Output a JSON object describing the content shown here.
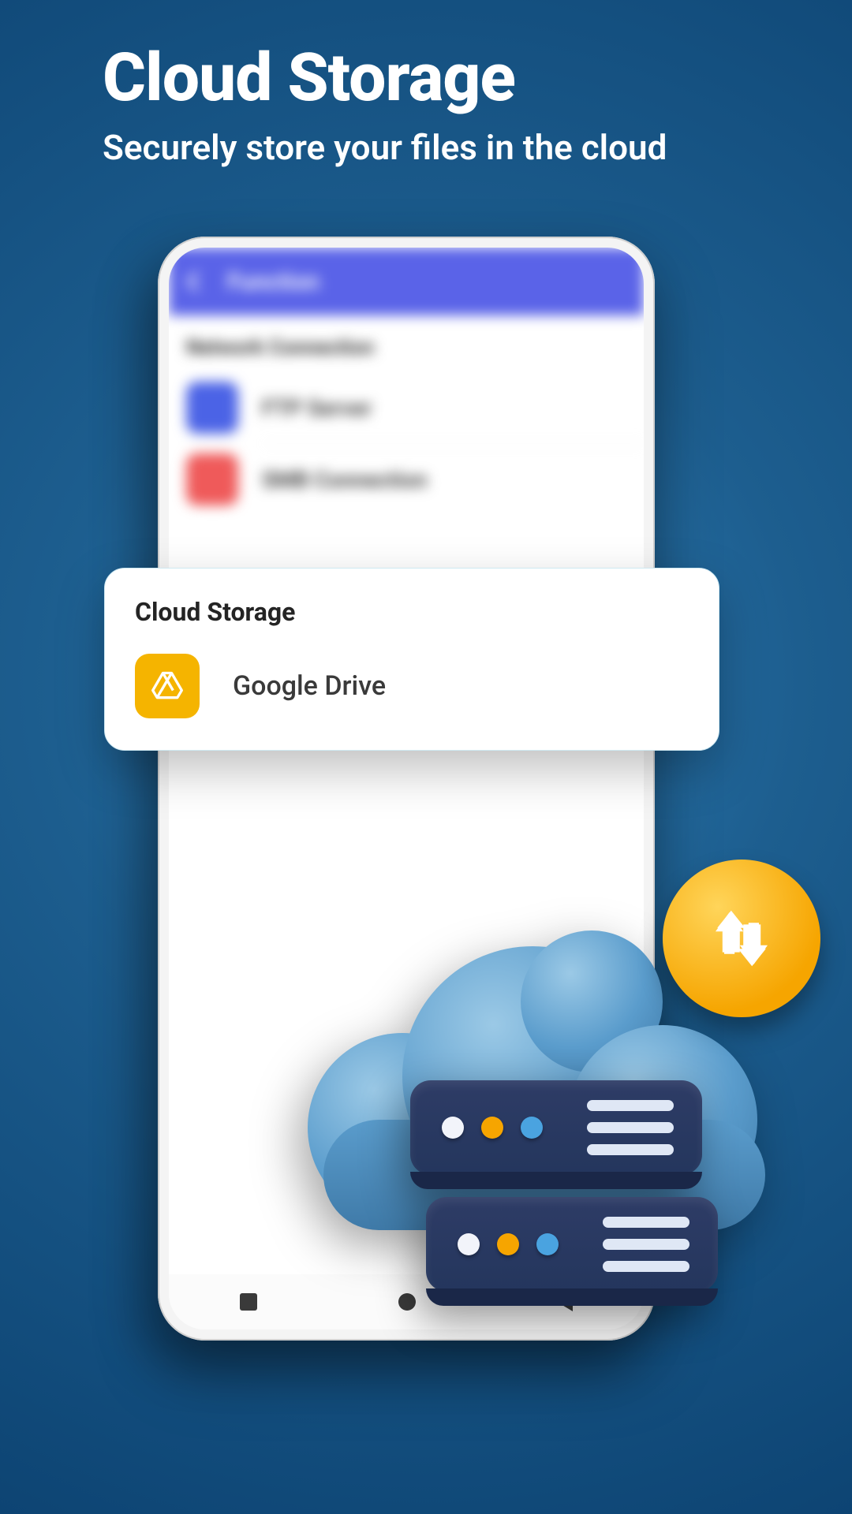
{
  "promo": {
    "title": "Cloud Storage",
    "subtitle": "Securely store your files in the cloud"
  },
  "app": {
    "header_title": "Function",
    "section_network": "Network Connection",
    "rows": [
      {
        "label": "FTP Server",
        "icon": "ftp-icon",
        "color": "#4b63e6"
      },
      {
        "label": "SMB Connection",
        "icon": "smb-icon",
        "color": "#ef5a5a"
      }
    ]
  },
  "card": {
    "title": "Cloud Storage",
    "item": {
      "label": "Google Drive",
      "icon": "google-drive-icon",
      "color": "#f5b400"
    }
  },
  "illustration": {
    "badge_icon": "sync-arrows-icon",
    "colors": {
      "cloud": "#5a9ccc",
      "badge": "#f6a500",
      "server": "#2e3c66"
    }
  }
}
